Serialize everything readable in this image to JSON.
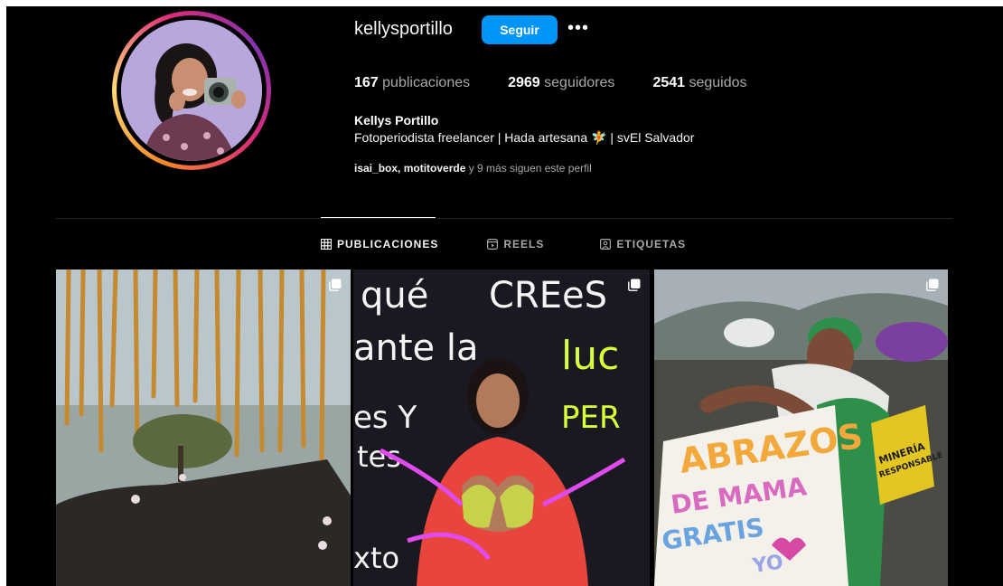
{
  "profile": {
    "username": "kellysportillo",
    "follow_label": "Seguir",
    "more_label": "•••",
    "stats": {
      "posts_count": "167",
      "posts_label": "publicaciones",
      "followers_count": "2969",
      "followers_label": "seguidores",
      "following_count": "2541",
      "following_label": "seguidos"
    },
    "full_name": "Kellys Portillo",
    "bio": "Fotoperiodista freelancer | Hada artesana 🧚 | svEl Salvador",
    "followed_by": {
      "users": "isai_box, motitoverde",
      "rest": " y 9 más siguen este perfil"
    }
  },
  "tabs": [
    {
      "label": "PUBLICACIONES",
      "icon": "grid-icon",
      "active": true
    },
    {
      "label": "REELS",
      "icon": "reels-icon",
      "active": false
    },
    {
      "label": "ETIQUETAS",
      "icon": "tagged-icon",
      "active": false
    }
  ],
  "posts": [
    {
      "type": "carousel",
      "content_text": []
    },
    {
      "type": "carousel",
      "content_text": [
        "qué",
        "CREeS",
        "ante la",
        "luc",
        "PER",
        "es Y",
        "tes",
        "xto"
      ]
    },
    {
      "type": "carousel",
      "content_text": [
        "ABRAZOS",
        "DE MAMA",
        "GRATIS",
        "YO",
        "MINERÍA",
        "RESPONSABLE"
      ]
    }
  ],
  "colors": {
    "accent": "#0095f6",
    "background": "#000000",
    "text": "#f5f5f5",
    "muted": "#a8a8a8"
  }
}
